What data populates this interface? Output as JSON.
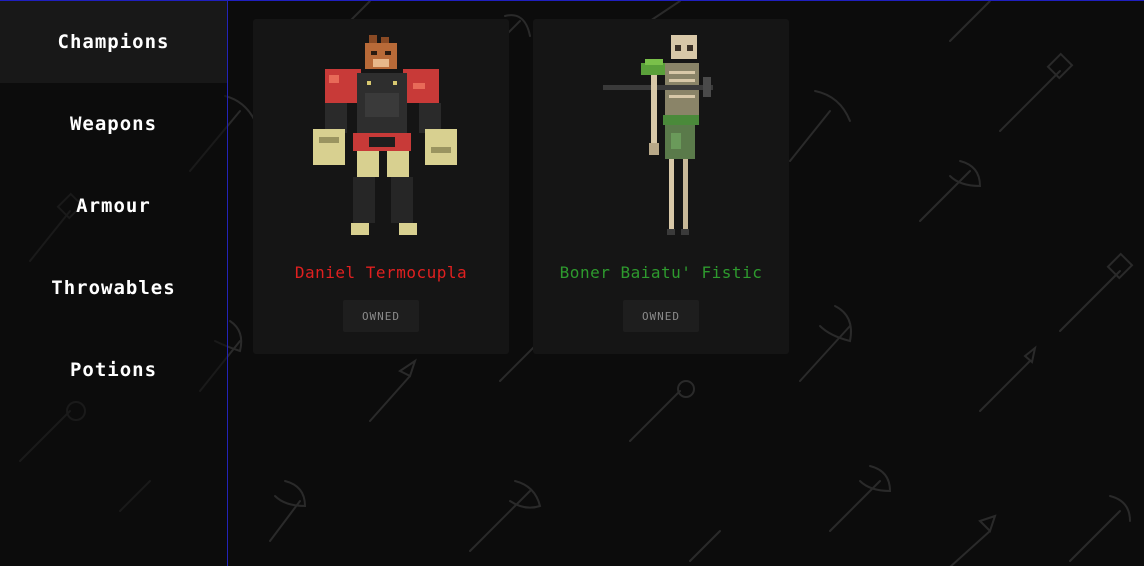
{
  "sidebar": {
    "items": [
      {
        "label": "Champions",
        "active": true
      },
      {
        "label": "Weapons",
        "active": false
      },
      {
        "label": "Armour",
        "active": false
      },
      {
        "label": "Throwables",
        "active": false
      },
      {
        "label": "Potions",
        "active": false
      }
    ]
  },
  "champions": [
    {
      "name": "Daniel Termocupla",
      "name_color": "#e02020",
      "status": "OWNED",
      "sprite": "armored-warrior-sprite"
    },
    {
      "name": "Boner Baiatu' Fistic",
      "name_color": "#2e9a2e",
      "status": "OWNED",
      "sprite": "skeleton-sprite"
    }
  ],
  "colors": {
    "background": "#0c0c0c",
    "card": "#151515",
    "accent_border": "#2323b8"
  }
}
